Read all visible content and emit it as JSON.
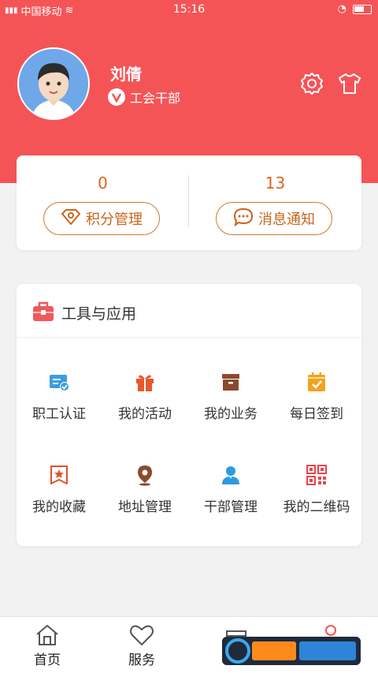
{
  "status_bar": {
    "carrier": "中国移动",
    "time": "15:16"
  },
  "profile": {
    "name": "刘倩",
    "role": "工会干部"
  },
  "stats": [
    {
      "value": "0",
      "label": "积分管理"
    },
    {
      "value": "13",
      "label": "消息通知"
    }
  ],
  "tools": {
    "title": "工具与应用",
    "items": [
      {
        "label": "职工认证",
        "icon": "id-card-icon"
      },
      {
        "label": "我的活动",
        "icon": "gift-icon"
      },
      {
        "label": "我的业务",
        "icon": "archive-box-icon"
      },
      {
        "label": "每日签到",
        "icon": "calendar-check-icon"
      },
      {
        "label": "我的收藏",
        "icon": "bookmark-star-icon"
      },
      {
        "label": "地址管理",
        "icon": "location-pin-icon"
      },
      {
        "label": "干部管理",
        "icon": "person-icon"
      },
      {
        "label": "我的二维码",
        "icon": "qr-code-icon"
      }
    ]
  },
  "tabbar": [
    {
      "label": "首页",
      "icon": "home-icon"
    },
    {
      "label": "服务",
      "icon": "heart-icon"
    }
  ],
  "colors": {
    "primary_red": "#f55457",
    "accent_orange": "#d9651d"
  }
}
